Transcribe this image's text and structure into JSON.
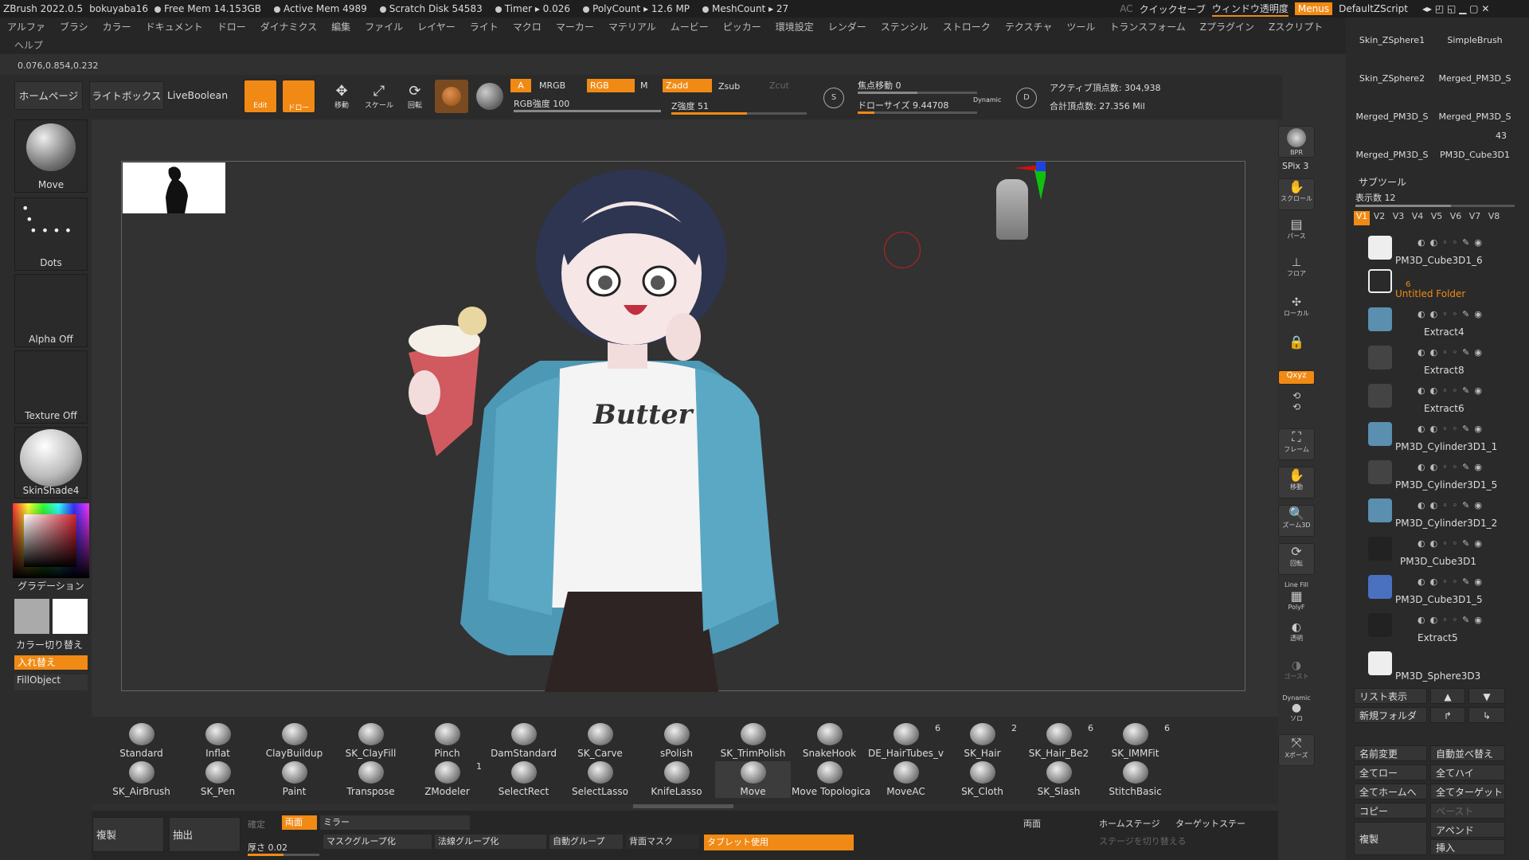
{
  "titlebar": {
    "app": "ZBrush 2022.0.5",
    "user": "bokuyaba16",
    "free_mem": "Free Mem 14.153GB",
    "active_mem": "Active Mem 4989",
    "scratch": "Scratch Disk 54583",
    "timer": "Timer ▸ 0.026",
    "polycount": "PolyCount ▸ 12.6 MP",
    "meshcount": "MeshCount ▸ 27",
    "ac": "AC",
    "quicksave": "クイックセーブ",
    "window_trans": "ウィンドウ透明度",
    "menus": "Menus",
    "script": "DefaultZScript"
  },
  "menu": [
    "アルファ",
    "ブラシ",
    "カラー",
    "ドキュメント",
    "ドロー",
    "ダイナミクス",
    "編集",
    "ファイル",
    "レイヤー",
    "ライト",
    "マクロ",
    "マーカー",
    "マテリアル",
    "ムービー",
    "ピッカー",
    "環境設定",
    "レンダー",
    "ステンシル",
    "ストローク",
    "テクスチャ",
    "ツール",
    "トランスフォーム",
    "Zプラグイン",
    "Zスクリプト"
  ],
  "help": "ヘルプ",
  "coords": "0.076,0.854,0.232",
  "top_buttons": {
    "home": "ホームページ",
    "lightbox": "ライトボックス",
    "liveboolean": "LiveBoolean",
    "edit": "Edit",
    "draw": "ドロー",
    "move": "移動",
    "scale": "スケール",
    "rotate": "回転"
  },
  "draw_controls": {
    "a": "A",
    "mrgb": "MRGB",
    "rgb": "RGB",
    "m": "M",
    "zadd": "Zadd",
    "zsub": "Zsub",
    "zcut": "Zcut",
    "rgb_intensity": "RGB強度 100",
    "z_intensity": "Z強度 51",
    "focal": "焦点移動 0",
    "draw_size": "ドローサイズ 9.44708",
    "dynamic": "Dynamic",
    "active_points": "アクティブ頂点数: 304,938",
    "total_points": "合計頂点数: 27.356 Mil"
  },
  "left_panel": {
    "move": "Move",
    "dots": "Dots",
    "alpha": "Alpha Off",
    "texture": "Texture Off",
    "material": "SkinShade4",
    "gradation": "グラデーション",
    "switch_color": "カラー切り替え",
    "swap": "入れ替え",
    "fillobject": "FillObject"
  },
  "canvas_text": {
    "shirt": "Butter"
  },
  "right_icons": {
    "bpr": "BPR",
    "spix": "SPix 3",
    "scroll": "スクロール",
    "persp": "パース",
    "floor": "フロア",
    "local": "ローカル",
    "xyz": "Qxyz",
    "frame": "フレーム",
    "move": "移動",
    "zoom": "ズーム3D",
    "rotate": "回転",
    "linefill": "Line Fill",
    "polyf": "PolyF",
    "transp": "透明",
    "ghost": "ゴースト",
    "solo": "ソロ",
    "dynamic": "Dynamic",
    "xpose": "Xポーズ"
  },
  "tool_thumbs": [
    "Skin_ZSphere1",
    "SimpleBrush",
    "Skin_ZSphere2",
    "Merged_PM3D_S",
    "Merged_PM3D_S",
    "Merged_PM3D_S",
    "Merged_PM3D_S",
    "PM3D_Cube3D1"
  ],
  "tool_thumb_count": "43",
  "subtool": {
    "title": "サブツール",
    "visible_count": "表示数 12",
    "versions": [
      "V1",
      "V2",
      "V3",
      "V4",
      "V5",
      "V6",
      "V7",
      "V8"
    ],
    "items": [
      "PM3D_Cube3D1_6",
      "Untitled Folder",
      "Extract4",
      "Extract8",
      "Extract6",
      "PM3D_Cylinder3D1_1",
      "PM3D_Cylinder3D1_5",
      "PM3D_Cylinder3D1_2",
      "PM3D_Cube3D1",
      "PM3D_Cube3D1_5",
      "Extract5",
      "PM3D_Sphere3D3"
    ],
    "folder_count": "6"
  },
  "subtool_buttons": {
    "list": "リスト表示",
    "newfolder": "新規フォルダ",
    "rename": "名前変更",
    "autosort": "自動並べ替え",
    "all_low": "全てロー",
    "all_high": "全てハイ",
    "all_home": "全てホームへ",
    "all_target": "全てターゲット",
    "copy": "コピー",
    "paste": "ペースト",
    "dup": "複製",
    "append": "アペンド",
    "insert": "挿入"
  },
  "brushes_row1": [
    {
      "n": "Standard"
    },
    {
      "n": "Inflat"
    },
    {
      "n": "ClayBuildup"
    },
    {
      "n": "SK_ClayFill"
    },
    {
      "n": "Pinch"
    },
    {
      "n": "DamStandard"
    },
    {
      "n": "SK_Carve"
    },
    {
      "n": "sPolish"
    },
    {
      "n": "SK_TrimPolish"
    },
    {
      "n": "SnakeHook"
    },
    {
      "n": "DE_HairTubes_v",
      "c": "6"
    },
    {
      "n": "SK_Hair",
      "c": "2"
    },
    {
      "n": "SK_Hair_Be2",
      "c": "6"
    },
    {
      "n": "SK_IMMFit",
      "c": "6"
    }
  ],
  "brushes_row2": [
    {
      "n": "SK_AirBrush"
    },
    {
      "n": "SK_Pen"
    },
    {
      "n": "Paint"
    },
    {
      "n": "Transpose"
    },
    {
      "n": "ZModeler",
      "c": "1"
    },
    {
      "n": "SelectRect"
    },
    {
      "n": "SelectLasso"
    },
    {
      "n": "KnifeLasso"
    },
    {
      "n": "Move"
    },
    {
      "n": "Move Topologica"
    },
    {
      "n": "MoveAC"
    },
    {
      "n": "SK_Cloth"
    },
    {
      "n": "SK_Slash"
    },
    {
      "n": "StitchBasic"
    }
  ],
  "bottom": {
    "dup": "複製",
    "extract": "抽出",
    "confirm": "確定",
    "both": "両面",
    "mirror": "ミラー",
    "thickness": "厚さ 0.02",
    "maskgroup": "マスクグループ化",
    "normalgroup": "法線グループ化",
    "autogroup": "自動グループ",
    "backmask": "背面マスク",
    "tablet": "タブレット使用",
    "both2": "両面",
    "homestage": "ホームステージ",
    "targetstage": "ターゲットステー",
    "switchstage": "ステージを切り替える"
  }
}
